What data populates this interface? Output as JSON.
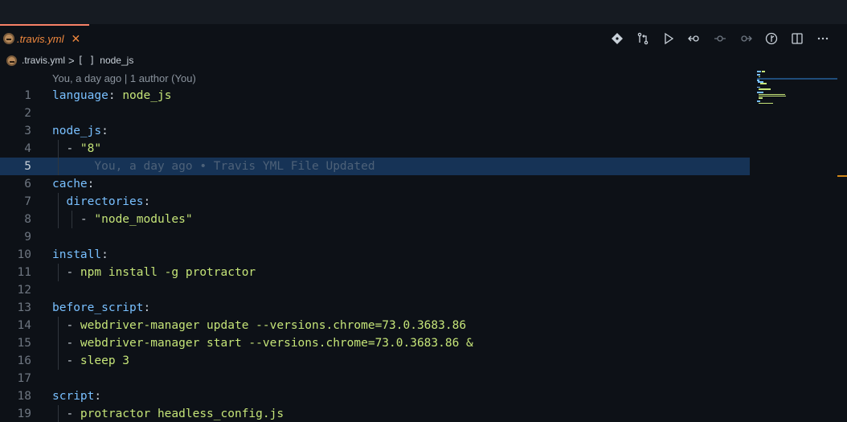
{
  "tab": {
    "label": ".travis.yml",
    "close": "✕"
  },
  "breadcrumb": {
    "file": ".travis.yml",
    "separator": ">",
    "symbol_icon": "[ ]",
    "symbol": "node_js"
  },
  "blame_header": "You, a day ago | 1 author (You)",
  "actions": [
    {
      "name": "git-commit-icon"
    },
    {
      "name": "compare-changes-icon"
    },
    {
      "name": "run-icon"
    },
    {
      "name": "go-back-icon"
    },
    {
      "name": "timeline-icon"
    },
    {
      "name": "go-forward-icon"
    },
    {
      "name": "toggle-blame-icon"
    },
    {
      "name": "split-editor-icon"
    },
    {
      "name": "more-actions-icon"
    }
  ],
  "lines": [
    {
      "n": "1",
      "key": "language",
      "colon": ": ",
      "value": "node_js"
    },
    {
      "n": "2"
    },
    {
      "n": "3",
      "key": "node_js",
      "colon": ":"
    },
    {
      "n": "4",
      "dash": "  - ",
      "str": "\"8\""
    },
    {
      "n": "5",
      "ghost": "      You, a day ago • Travis YML File Updated"
    },
    {
      "n": "6",
      "key": "cache",
      "colon": ":"
    },
    {
      "n": "7",
      "indent": "  ",
      "key": "directories",
      "colon": ":"
    },
    {
      "n": "8",
      "dash": "    - ",
      "str": "\"node_modules\""
    },
    {
      "n": "9"
    },
    {
      "n": "10",
      "key": "install",
      "colon": ":"
    },
    {
      "n": "11",
      "dash": "  - ",
      "value": "npm install -g protractor"
    },
    {
      "n": "12"
    },
    {
      "n": "13",
      "key": "before_script",
      "colon": ":"
    },
    {
      "n": "14",
      "dash": "  - ",
      "value": "webdriver-manager update --versions.chrome=73.0.3683.86"
    },
    {
      "n": "15",
      "dash": "  - ",
      "value": "webdriver-manager start --versions.chrome=73.0.3683.86 &"
    },
    {
      "n": "16",
      "dash": "  - ",
      "value": "sleep 3"
    },
    {
      "n": "17"
    },
    {
      "n": "18",
      "key": "script",
      "colon": ":"
    },
    {
      "n": "19",
      "dash": "  - ",
      "value": "protractor headless_config.js"
    }
  ],
  "colors": {
    "accent": "#f78166",
    "key": "#79c0ff",
    "value": "#c5e478",
    "highlight": "#163356",
    "background": "#0d1117"
  }
}
